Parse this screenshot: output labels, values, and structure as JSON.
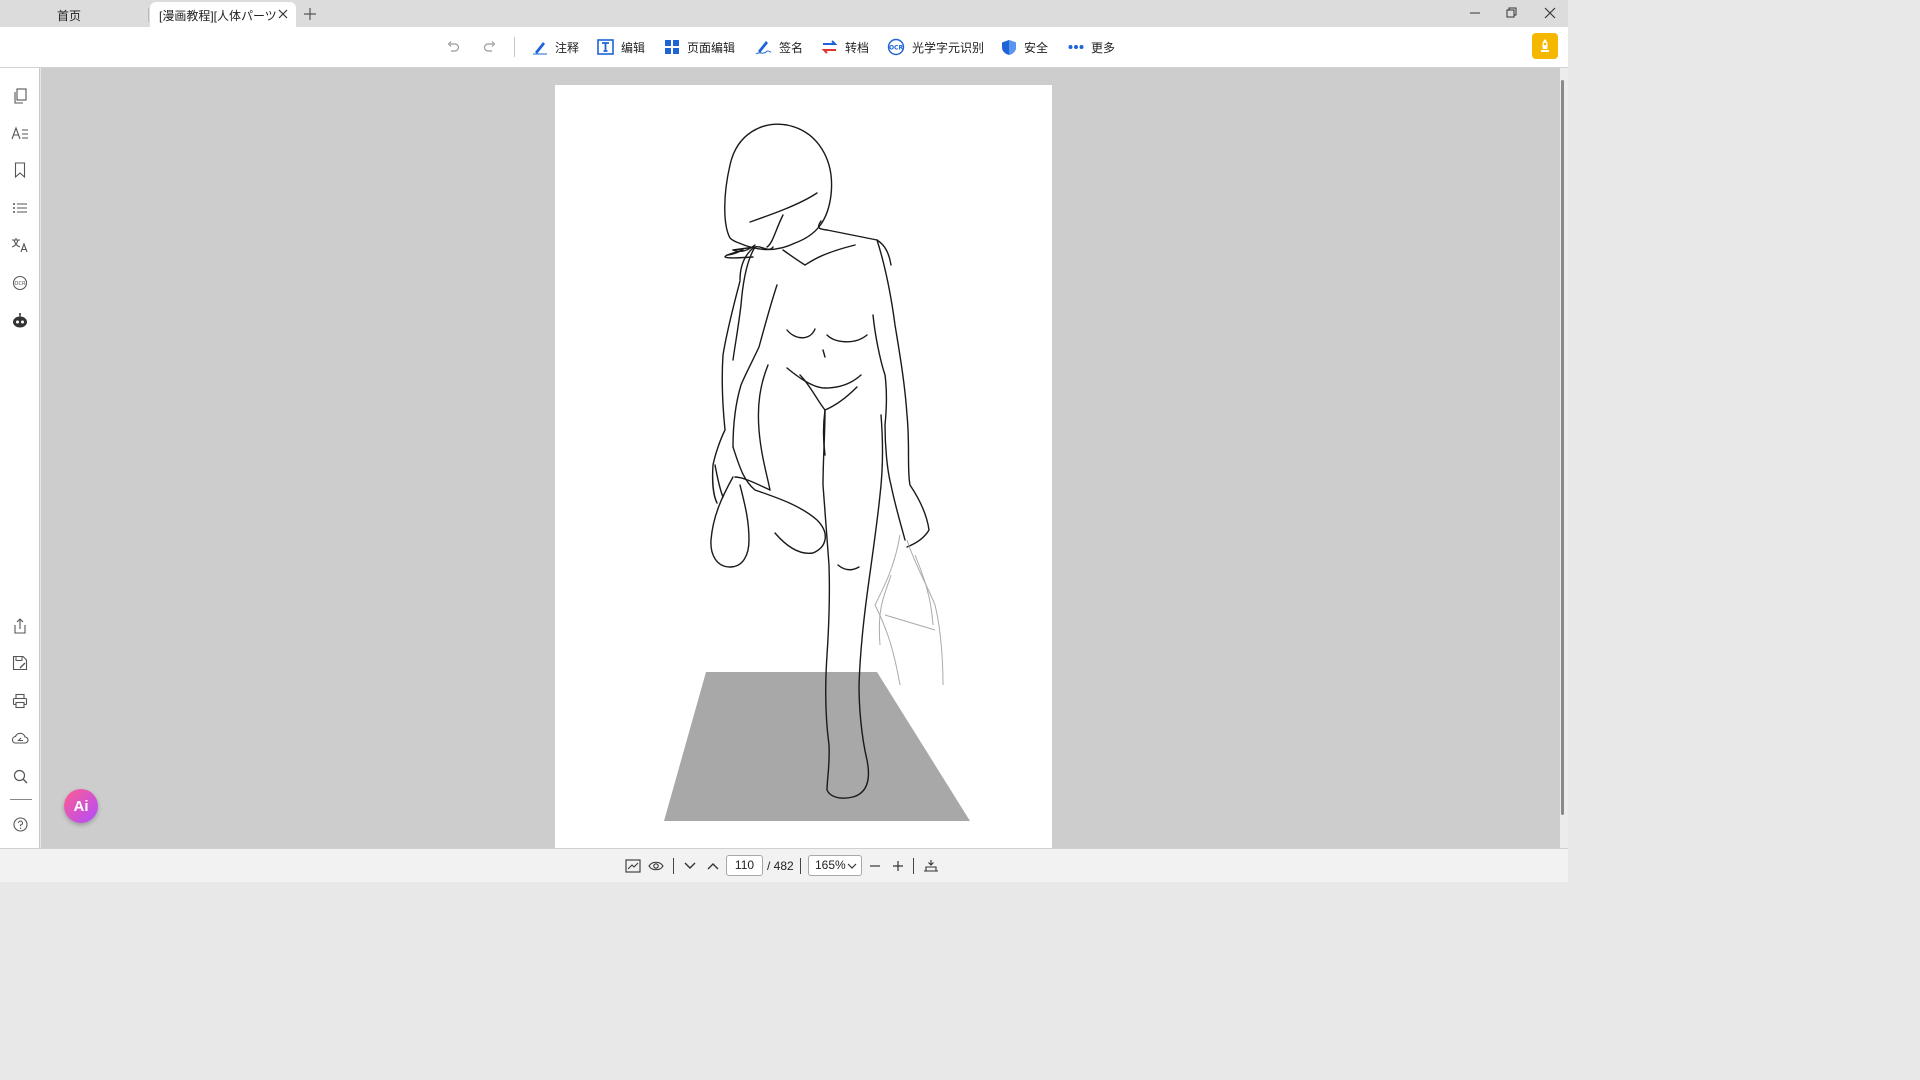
{
  "tabs": {
    "home_label": "首页",
    "active_label": "[漫画教程][人体パーツ素..."
  },
  "toolbar": {
    "annotate": "注释",
    "edit": "编辑",
    "page_edit": "页面编辑",
    "sign": "签名",
    "convert": "转档",
    "ocr": "光学字元识别",
    "security": "安全",
    "more": "更多"
  },
  "sidebar": {
    "icons": [
      "pages-icon",
      "text-style-icon",
      "bookmark-icon",
      "outline-list-icon",
      "translate-icon",
      "ocr-icon",
      "ai-robot-icon",
      "share-icon",
      "save-as-icon",
      "print-icon",
      "cloud-icon",
      "search-icon",
      "help-icon"
    ]
  },
  "ai_button": {
    "label": "Ai"
  },
  "bottombar": {
    "current_page": "110",
    "total_pages": "/ 482",
    "zoom": "165%"
  },
  "colors": {
    "toolbar_icon_blue": "#1e64d8",
    "premium_yellow": "#f5b800",
    "canvas_gray": "#cdcdcd"
  }
}
